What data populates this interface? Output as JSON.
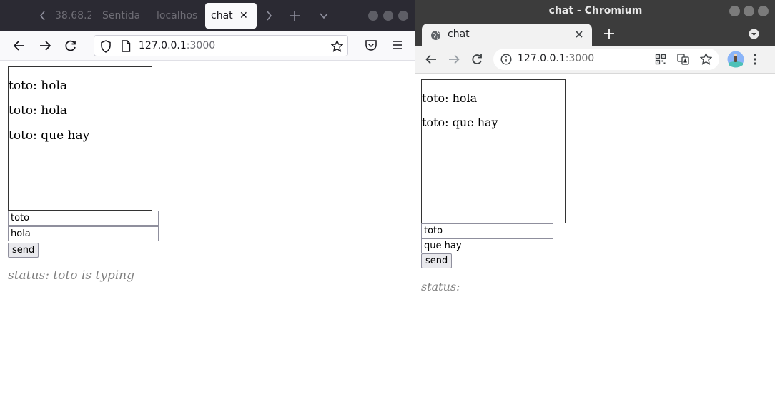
{
  "firefox": {
    "tabs": [
      {
        "label": "38.68.2"
      },
      {
        "label": "Sentida"
      },
      {
        "label": "localhos"
      },
      {
        "label": "chat",
        "active": true
      }
    ],
    "url": {
      "host": "127.0.0.1",
      "port": ":3000"
    }
  },
  "chromium": {
    "window_title": "chat - Chromium",
    "tab": {
      "label": "chat"
    },
    "url": {
      "host": "127.0.0.1",
      "port": ":3000"
    }
  },
  "left_page": {
    "messages": [
      "toto: hola",
      "toto: hola",
      "toto: que hay"
    ],
    "name_value": "toto",
    "message_value": "hola",
    "send_label": "send",
    "status": "status: toto is typing"
  },
  "right_page": {
    "messages": [
      "toto: hola",
      "toto: que hay"
    ],
    "name_value": "toto",
    "message_value": "que hay",
    "send_label": "send",
    "status": "status:"
  },
  "colors": {
    "firefox_tabbar": "#2b2a33",
    "chromium_titlebar": "#3c3c3c",
    "status_text": "#808080"
  }
}
